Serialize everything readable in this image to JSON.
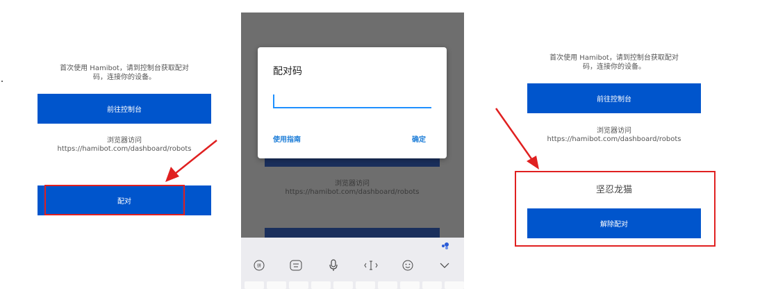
{
  "panel1": {
    "intro": "首次使用 Hamibot，请到控制台获取配对\n码，连接你的设备。",
    "console_button": "前往控制台",
    "visit_label": "浏览器访问",
    "visit_url": "https://hamibot.com/dashboard/robots",
    "pair_button": "配对"
  },
  "panel2": {
    "background_visit_label": "浏览器访问",
    "background_visit_url": "https://hamibot.com/dashboard/robots",
    "dialog": {
      "title": "配对码",
      "input_value": "",
      "guide_button": "使用指南",
      "confirm_button": "确定"
    },
    "keyboard_icons": [
      "keyboard-mode-icon",
      "emoji-keyboard-icon",
      "microphone-icon",
      "text-cursor-icon",
      "smiley-icon",
      "chevron-down-icon"
    ]
  },
  "panel3": {
    "intro": "首次使用 Hamibot，请到控制台获取配对\n码，连接你的设备。",
    "console_button": "前往控制台",
    "visit_label": "浏览器访问",
    "visit_url": "https://hamibot.com/dashboard/robots",
    "device_name": "坚忍龙猫",
    "unpair_button": "解除配对"
  },
  "colors": {
    "primary_button": "#0055cc",
    "annotation_red": "#e02020",
    "dialog_accent": "#1e90ff"
  }
}
